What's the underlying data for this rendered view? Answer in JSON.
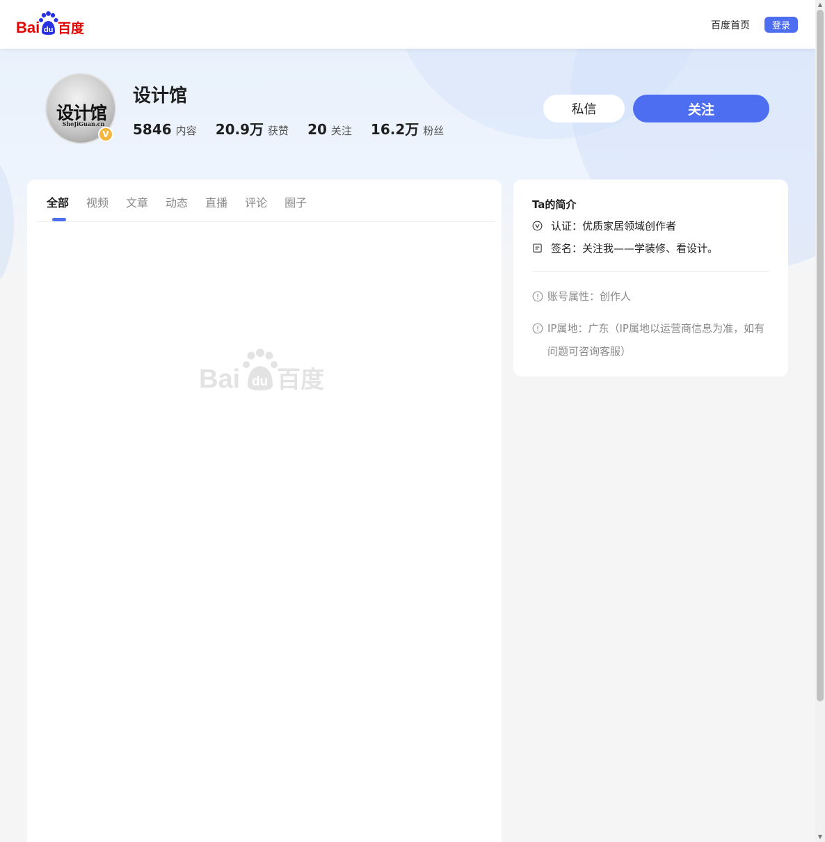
{
  "header": {
    "logo_text": "Bai百度",
    "logo_du": "du",
    "home_link": "百度首页",
    "login_label": "登录"
  },
  "profile": {
    "name": "设计馆",
    "avatar_text": "设计馆",
    "avatar_sub": "SheJiGuan.cn",
    "verify_mark": "V",
    "stats": [
      {
        "value": "5846",
        "label": "内容"
      },
      {
        "value": "20.9万",
        "label": "获赞"
      },
      {
        "value": "20",
        "label": "关注"
      },
      {
        "value": "16.2万",
        "label": "粉丝"
      }
    ],
    "message_button": "私信",
    "follow_button": "关注"
  },
  "tabs": [
    {
      "label": "全部",
      "active": true
    },
    {
      "label": "视频"
    },
    {
      "label": "文章"
    },
    {
      "label": "动态"
    },
    {
      "label": "直播"
    },
    {
      "label": "评论"
    },
    {
      "label": "圈子"
    }
  ],
  "placeholder_logo": "Bai百度",
  "intro": {
    "title": "Ta的简介",
    "certification": "认证：优质家居领域创作者",
    "signature": "签名：关注我——学装修、看设计。",
    "account_type": "账号属性：创作人",
    "ip_location": "IP属地：广东（IP属地以运营商信息为准，如有问题可咨询客服）"
  },
  "colors": {
    "brand_blue": "#4e6ef2",
    "baidu_red": "#e10602",
    "baidu_blue": "#2932e1"
  }
}
